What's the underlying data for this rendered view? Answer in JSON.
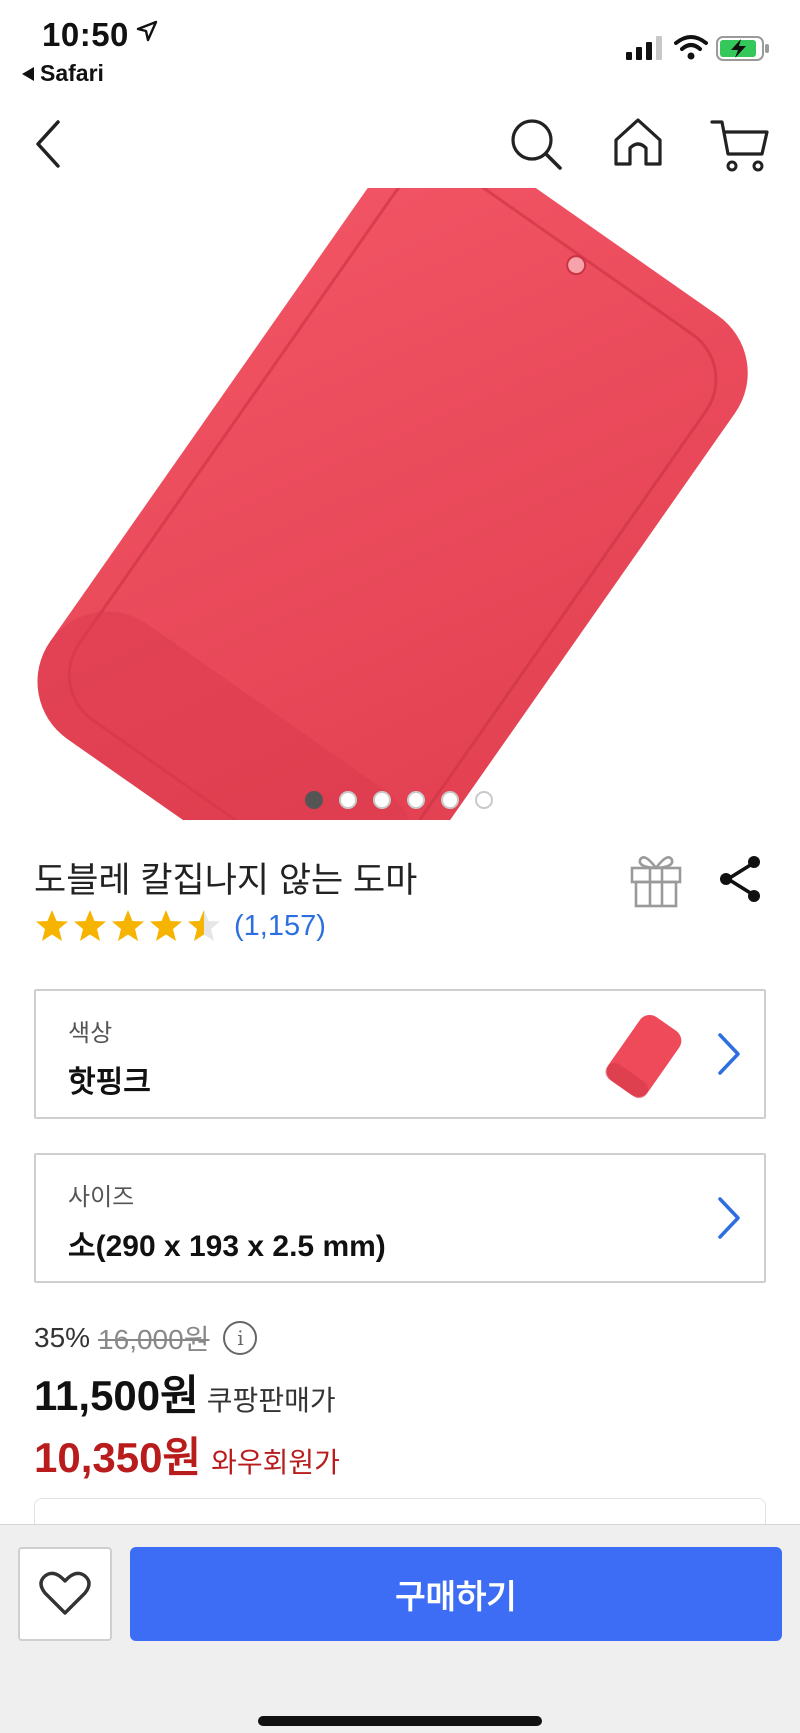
{
  "status_bar": {
    "time": "10:50",
    "back_app": "Safari",
    "icons": [
      "location-arrow-icon",
      "signal-icon",
      "wifi-icon",
      "battery-charging-icon"
    ],
    "battery_color": "#34c759"
  },
  "nav": {
    "icons": [
      "back-chevron-icon",
      "search-icon",
      "home-icon",
      "cart-icon"
    ]
  },
  "product": {
    "image_color": "#ee4a5a",
    "image_count": 6,
    "active_image_index": 0,
    "title": "도블레 칼집나지 않는 도마",
    "rating": 4.5,
    "review_count": "(1,157)"
  },
  "options": {
    "color": {
      "label": "색상",
      "value": "핫핑크"
    },
    "size": {
      "label": "사이즈",
      "value": "소(290 x 193 x 2.5 mm)"
    }
  },
  "price": {
    "discount": "35%",
    "original": "16,000원",
    "info_icon_glyph": "i",
    "sale": "11,500원",
    "sale_label": "쿠팡판매가",
    "wow": "10,350원",
    "wow_label": "와우회원가"
  },
  "bottom": {
    "buy_label": "구매하기",
    "accent_color": "#3d6df5"
  }
}
